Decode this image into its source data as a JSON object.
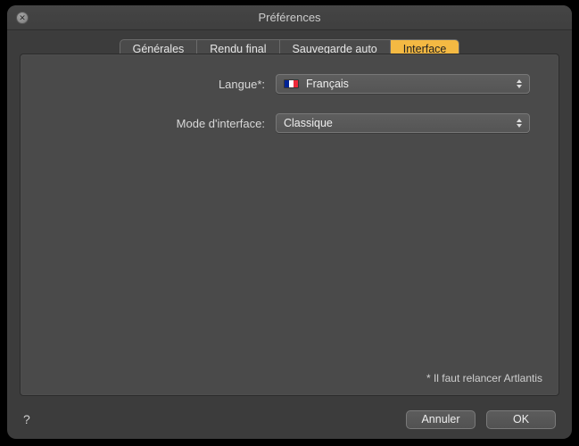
{
  "window": {
    "title": "Préférences"
  },
  "tabs": [
    {
      "label": "Générales"
    },
    {
      "label": "Rendu final"
    },
    {
      "label": "Sauvegarde auto"
    },
    {
      "label": "Interface",
      "active": true
    }
  ],
  "form": {
    "language": {
      "label": "Langue*:",
      "value": "Français",
      "flag": "fr"
    },
    "interface_mode": {
      "label": "Mode d'interface:",
      "value": "Classique"
    }
  },
  "footnote": "* Il faut relancer Artlantis",
  "footer": {
    "help": "?",
    "cancel": "Annuler",
    "ok": "OK"
  }
}
